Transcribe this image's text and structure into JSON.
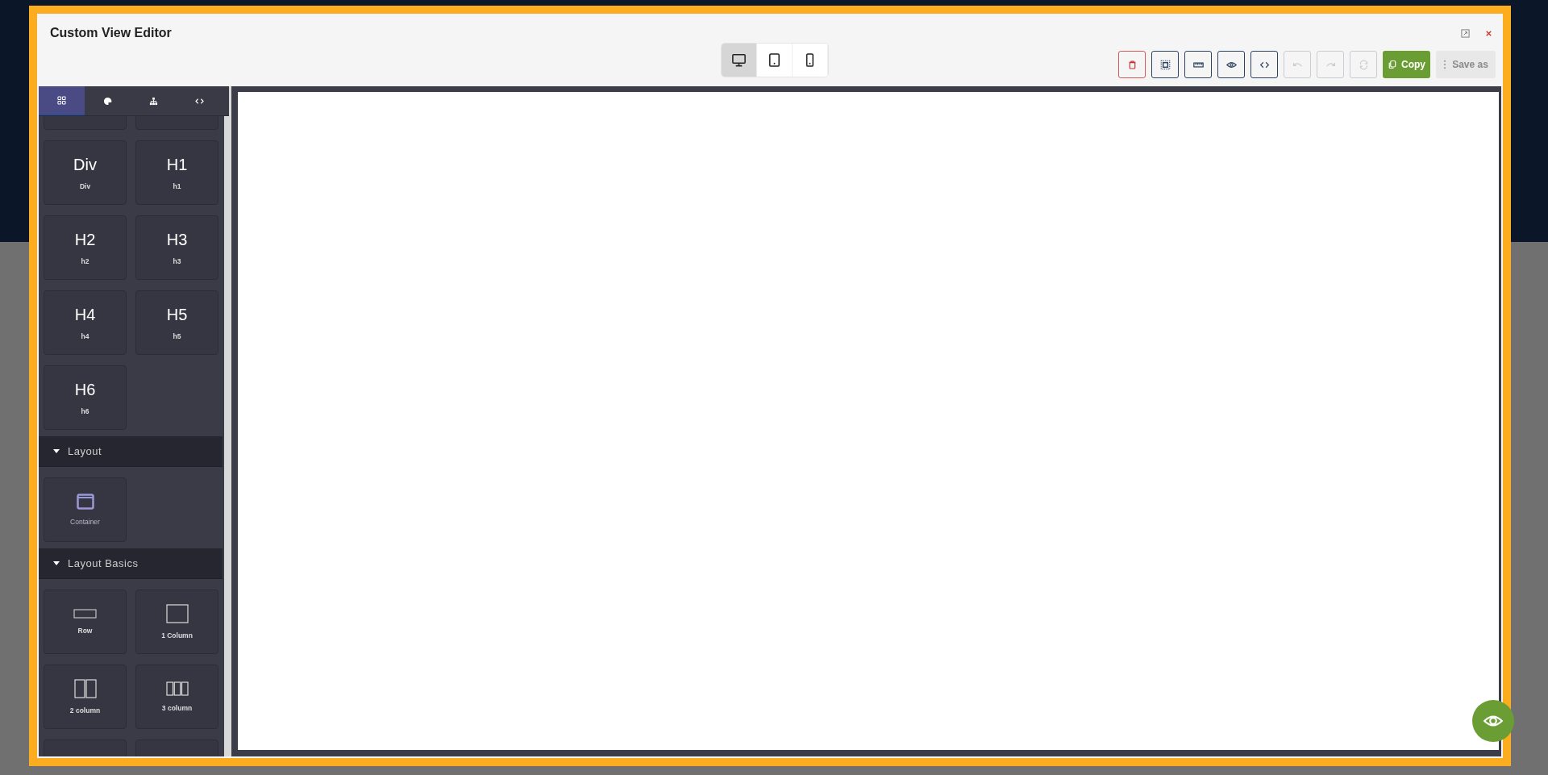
{
  "window": {
    "title": "Custom View Editor"
  },
  "devices": [
    {
      "kind": "desktop",
      "selected": true
    },
    {
      "kind": "tablet",
      "selected": false
    },
    {
      "kind": "mobile",
      "selected": false
    }
  ],
  "toolbar": [
    {
      "kind": "delete",
      "disabled": false
    },
    {
      "kind": "select",
      "disabled": false
    },
    {
      "kind": "ruler",
      "disabled": false
    },
    {
      "kind": "preview",
      "disabled": false
    },
    {
      "kind": "code",
      "disabled": false
    },
    {
      "kind": "undo",
      "disabled": true
    },
    {
      "kind": "redo",
      "disabled": true
    },
    {
      "kind": "refresh",
      "disabled": true
    }
  ],
  "copy_button": {
    "label": "Copy",
    "disabled": false
  },
  "save_as_button": {
    "label": "Save as",
    "disabled": true
  },
  "sidebar_tabs": [
    {
      "kind": "blocks",
      "selected": true
    },
    {
      "kind": "style",
      "selected": false
    },
    {
      "kind": "layers",
      "selected": false
    },
    {
      "kind": "code",
      "selected": false
    }
  ],
  "blocks": [
    {
      "kind": "blank"
    },
    {
      "kind": "blank"
    },
    {
      "kind": "glyph",
      "glyph": "Div",
      "label": "Div"
    },
    {
      "kind": "glyph",
      "glyph": "H1",
      "label": "h1"
    },
    {
      "kind": "glyph",
      "glyph": "H2",
      "label": "h2"
    },
    {
      "kind": "glyph",
      "glyph": "H3",
      "label": "h3"
    },
    {
      "kind": "glyph",
      "glyph": "H4",
      "label": "h4"
    },
    {
      "kind": "glyph",
      "glyph": "H5",
      "label": "h5"
    },
    {
      "kind": "glyph",
      "glyph": "H6",
      "label": "h6"
    }
  ],
  "sections": [
    {
      "title": "Layout",
      "expanded": true,
      "items": [
        {
          "kind": "container",
          "label": "Container"
        }
      ]
    },
    {
      "title": "Layout Basics",
      "expanded": true,
      "items": [
        {
          "kind": "row",
          "label": "Row"
        },
        {
          "kind": "column1",
          "label": "1 Column"
        },
        {
          "kind": "column2",
          "label": "2 column"
        },
        {
          "kind": "column3",
          "label": "3 column"
        },
        {
          "kind": "blank"
        },
        {
          "kind": "blank"
        }
      ]
    }
  ]
}
